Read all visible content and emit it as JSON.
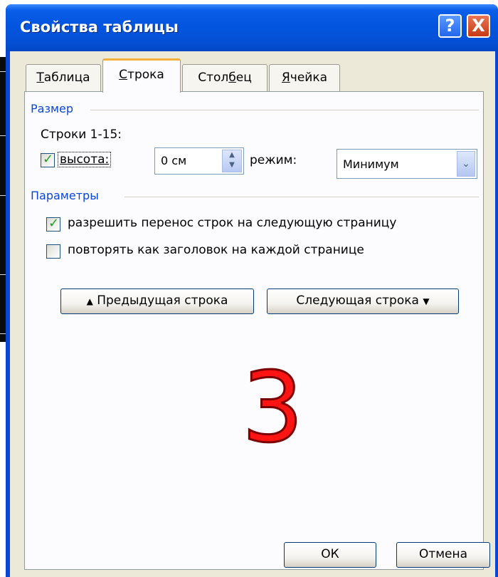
{
  "window": {
    "title": "Свойства таблицы",
    "help_label": "?",
    "close_label": "X"
  },
  "tabs": [
    {
      "label": "Таблица",
      "mnemonic": "Т",
      "rest": "аблица",
      "active": false
    },
    {
      "label": "Строка",
      "mnemonic": "С",
      "rest": "трока",
      "active": true
    },
    {
      "label": "Столбец",
      "pre": "Стол",
      "mnemonic": "б",
      "rest": "ец",
      "active": false
    },
    {
      "label": "Ячейка",
      "mnemonic": "Я",
      "rest": "чейка",
      "active": false
    }
  ],
  "size_group": {
    "label": "Размер",
    "rows_label": "Строки 1-15:",
    "height_checkbox": {
      "label": "высота:",
      "checked": true
    },
    "height_value": "0 см",
    "mode_label": "режим:",
    "mode_value": "Минимум"
  },
  "params_group": {
    "label": "Параметры",
    "allow_break": {
      "label": "разрешить перенос строк на следующую страницу",
      "checked": true
    },
    "repeat_header": {
      "label": "повторять как заголовок на каждой странице",
      "checked": false
    }
  },
  "nav": {
    "prev_label": "Предыдущая строка",
    "next_label": "Следующая строка",
    "prev_icon": "up-arrow-icon",
    "next_icon": "down-arrow-icon"
  },
  "overlay_number": "3",
  "footer": {
    "ok_label": "ОК",
    "cancel_label": "Отмена"
  }
}
